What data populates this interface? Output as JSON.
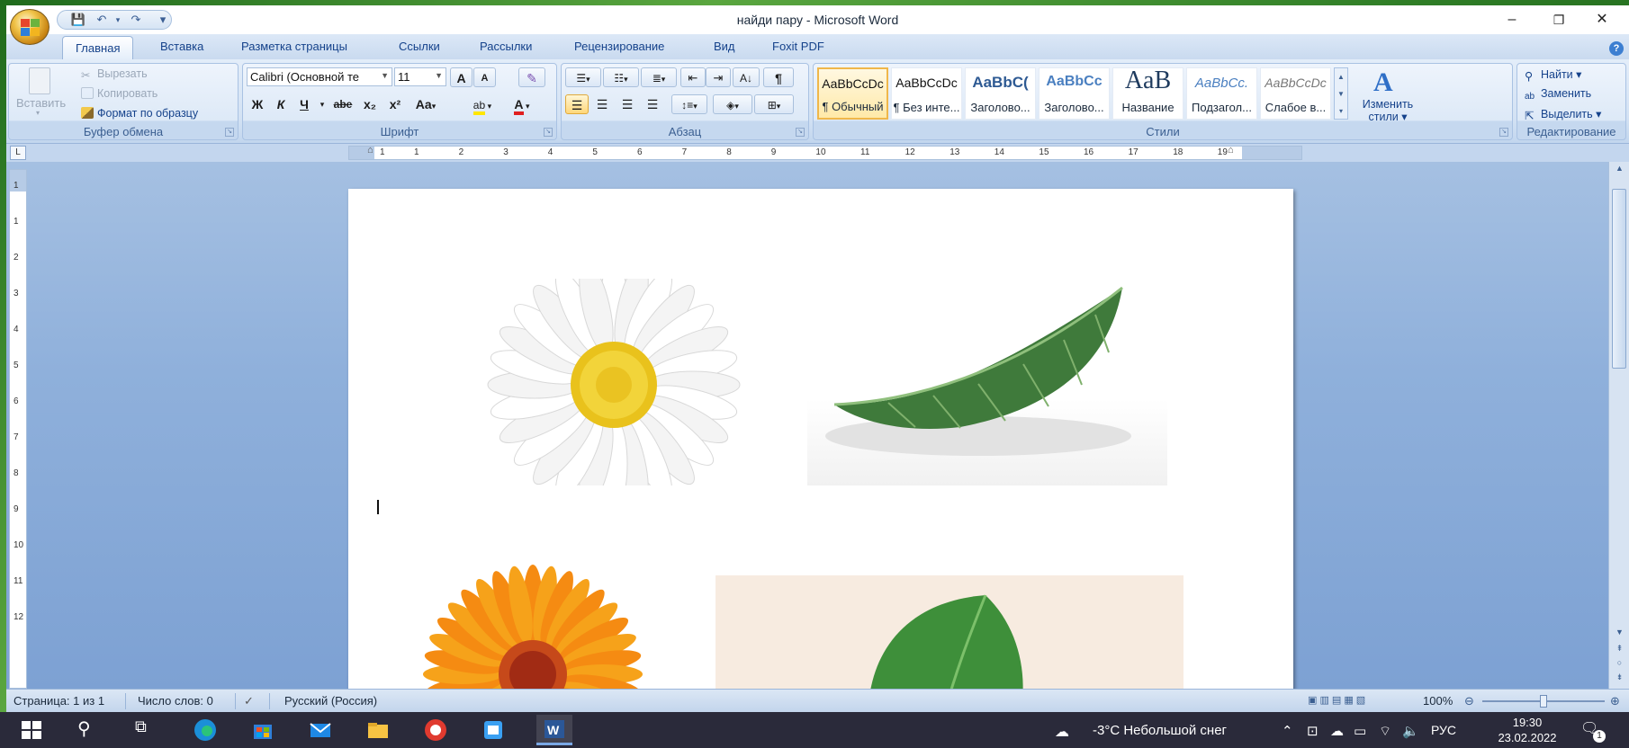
{
  "window": {
    "title": "найди пару - Microsoft Word",
    "controls": {
      "minimize": "–",
      "restore": "❐",
      "close": "✕"
    }
  },
  "qat": {
    "save": "💾",
    "undo": "↶",
    "redo": "↷",
    "customize": "▾"
  },
  "tabs": [
    {
      "label": "Главная",
      "active": true
    },
    {
      "label": "Вставка"
    },
    {
      "label": "Разметка страницы"
    },
    {
      "label": "Ссылки"
    },
    {
      "label": "Рассылки"
    },
    {
      "label": "Рецензирование"
    },
    {
      "label": "Вид"
    },
    {
      "label": "Foxit PDF"
    }
  ],
  "ribbon": {
    "clipboard": {
      "label": "Буфер обмена",
      "paste": "Вставить",
      "cut": "Вырезать",
      "copy": "Копировать",
      "format_painter": "Формат по образцу"
    },
    "font": {
      "label": "Шрифт",
      "font_name": "Calibri (Основной те",
      "font_size": "11",
      "grow": "A",
      "shrink": "A",
      "bold": "Ж",
      "italic": "К",
      "underline": "Ч",
      "strike": "abe",
      "subscript": "x₂",
      "superscript": "x²",
      "case": "Aa",
      "highlight": "ab",
      "font_color": "A"
    },
    "paragraph": {
      "label": "Абзац",
      "pilcrow": "¶"
    },
    "styles": {
      "label": "Стили",
      "items": [
        {
          "sample": "AaBbCcDc",
          "name": "¶ Обычный",
          "selected": true
        },
        {
          "sample": "AaBbCcDc",
          "name": "¶ Без инте..."
        },
        {
          "sample": "AaBbC(",
          "name": "Заголово..."
        },
        {
          "sample": "AaBbCc",
          "name": "Заголово..."
        },
        {
          "sample": "AaB",
          "name": "Название"
        },
        {
          "sample": "AaBbCc.",
          "name": "Подзагол..."
        },
        {
          "sample": "AaBbCcDc",
          "name": "Слабое в..."
        }
      ],
      "change_styles_line1": "Изменить",
      "change_styles_line2": "стили"
    },
    "editing": {
      "label": "Редактирование",
      "find": "Найти",
      "replace": "Заменить",
      "select": "Выделить"
    }
  },
  "ruler": {
    "tab_selector": "L",
    "numbers": [
      "1",
      "1",
      "2",
      "3",
      "4",
      "5",
      "6",
      "7",
      "8",
      "9",
      "10",
      "11",
      "12",
      "13",
      "14",
      "15",
      "16",
      "17",
      "18",
      "19"
    ],
    "vnumbers": [
      "1",
      "1",
      "2",
      "3",
      "4",
      "5",
      "6",
      "7",
      "8",
      "9",
      "10",
      "11",
      "12"
    ]
  },
  "statusbar": {
    "page": "Страница: 1 из 1",
    "words": "Число слов: 0",
    "language": "Русский (Россия)",
    "zoom": "100%"
  },
  "taskbar": {
    "weather": "-3°C  Небольшой снег",
    "lang": "РУС",
    "time": "19:30",
    "date": "23.02.2022",
    "notifications": "1"
  },
  "colors": {
    "ribbon_text": "#15428b",
    "selected_style_border": "#f0b74a",
    "taskbar_bg": "#2a2a3a"
  }
}
